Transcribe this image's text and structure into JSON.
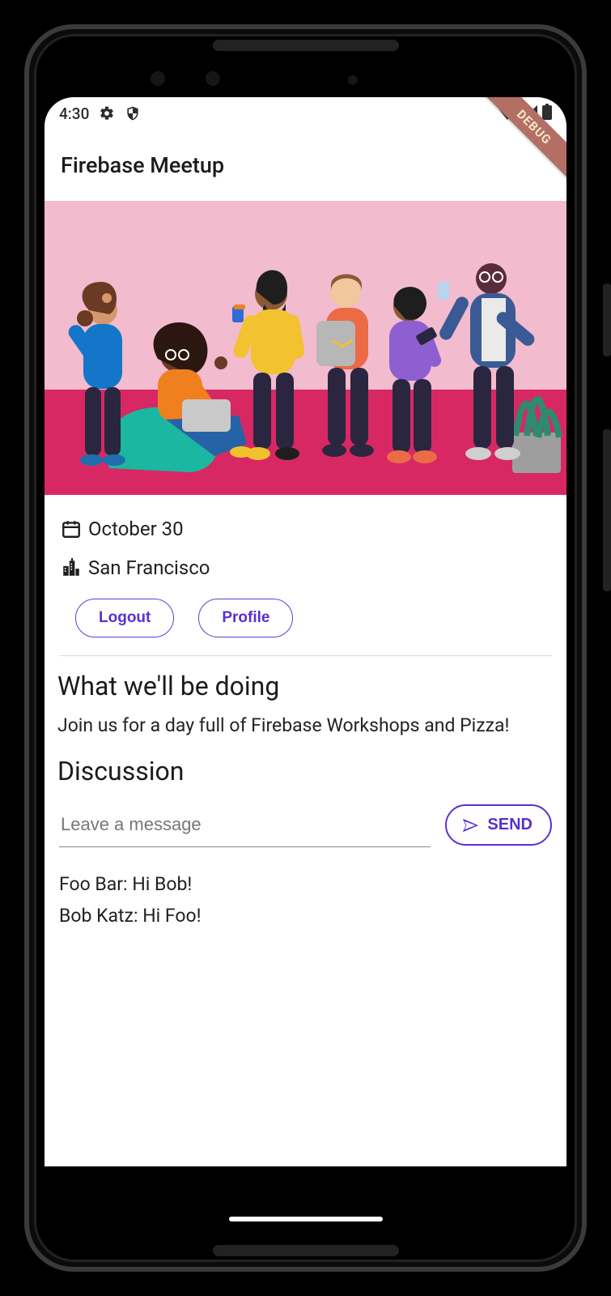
{
  "statusbar": {
    "time": "4:30"
  },
  "debug_banner": "DEBUG",
  "appbar": {
    "title": "Firebase Meetup"
  },
  "event": {
    "date": "October 30",
    "location": "San Francisco"
  },
  "buttons": {
    "logout": "Logout",
    "profile": "Profile"
  },
  "sections": {
    "about_title": "What we'll be doing",
    "about_body": "Join us for a day full of Firebase Workshops and Pizza!",
    "discussion_title": "Discussion"
  },
  "message_input": {
    "placeholder": "Leave a message",
    "value": ""
  },
  "send_label": "SEND",
  "messages": [
    {
      "text": "Foo Bar: Hi Bob!"
    },
    {
      "text": "Bob Katz: Hi Foo!"
    }
  ],
  "colors": {
    "accent": "#5a30ce"
  }
}
